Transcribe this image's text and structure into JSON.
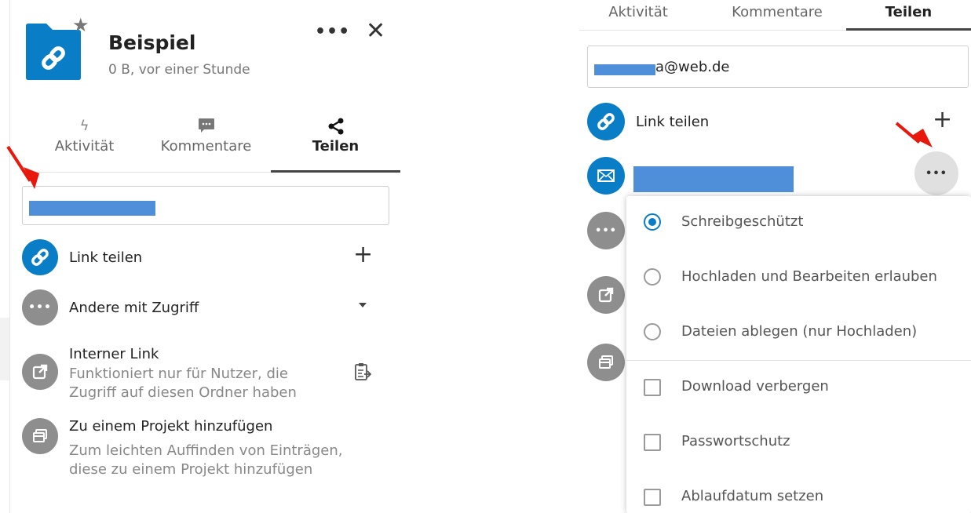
{
  "left": {
    "file": {
      "name": "Beispiel",
      "meta": "0 B, vor einer Stunde"
    },
    "tabs": [
      {
        "label": "Aktivität"
      },
      {
        "label": "Kommentare"
      },
      {
        "label": "Teilen"
      }
    ],
    "share_input_value": "",
    "link_share_label": "Link teilen",
    "others_access_label": "Andere mit Zugriff",
    "internal_link": {
      "title": "Interner Link",
      "desc_line1": "Funktioniert nur für Nutzer, die",
      "desc_line2": "Zugriff auf diesen Ordner haben"
    },
    "project": {
      "title": "Zu einem Projekt hinzufügen",
      "desc_line1": "Zum leichten Auffinden von Einträgen,",
      "desc_line2": "diese zu einem Projekt hinzufügen"
    }
  },
  "right": {
    "tabs": [
      {
        "label": "Aktivität"
      },
      {
        "label": "Kommentare"
      },
      {
        "label": "Teilen"
      }
    ],
    "share_input_suffix": "a@web.de",
    "link_share_label": "Link teilen",
    "menu": {
      "radios": [
        {
          "label": "Schreibgeschützt",
          "checked": true
        },
        {
          "label": "Hochladen und Bearbeiten erlauben",
          "checked": false
        },
        {
          "label": "Dateien ablegen (nur Hochladen)",
          "checked": false
        }
      ],
      "checkboxes": [
        {
          "label": "Download verbergen"
        },
        {
          "label": "Passwortschutz"
        },
        {
          "label": "Ablaufdatum setzen"
        }
      ]
    }
  },
  "colors": {
    "accent": "#0a7dc7",
    "annotation_arrow": "#e8180c",
    "redaction": "#4f8fd9"
  }
}
